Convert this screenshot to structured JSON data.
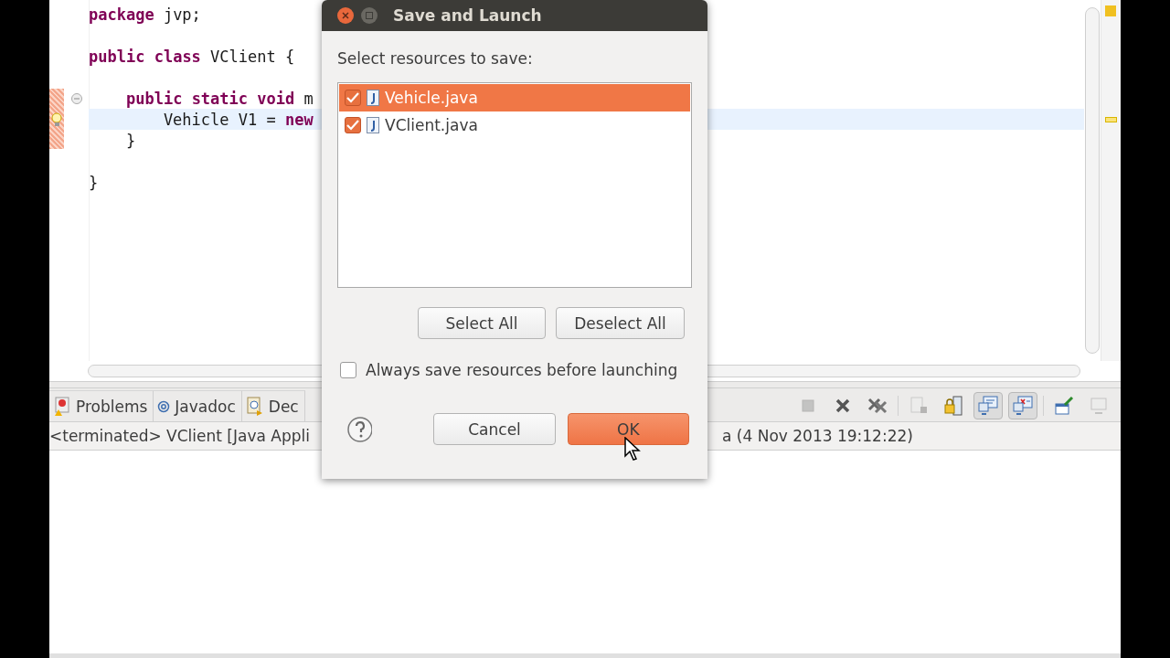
{
  "editor": {
    "lines": [
      {
        "kind": "code",
        "text": "**package** jvp;",
        "current": false,
        "fold": false,
        "warning": false
      },
      {
        "kind": "blank"
      },
      {
        "kind": "code",
        "text": "**public** **class** VClient {",
        "current": false,
        "fold": false,
        "warning": false
      },
      {
        "kind": "blank"
      },
      {
        "kind": "code",
        "text": "    **public** **static** **void** m",
        "current": false,
        "fold": true,
        "warning": false
      },
      {
        "kind": "code",
        "text": "        Vehicle V1 = **new**",
        "current": true,
        "fold": false,
        "warning": true
      },
      {
        "kind": "code",
        "text": "    }",
        "current": false,
        "fold": false,
        "warning": false
      },
      {
        "kind": "blank"
      },
      {
        "kind": "code",
        "text": "}",
        "current": false,
        "fold": false,
        "warning": false
      }
    ]
  },
  "panel": {
    "tabs": [
      {
        "kind": "problems",
        "label": "Problems",
        "selected": false
      },
      {
        "kind": "javadoc",
        "label": "Javadoc",
        "selected": false
      },
      {
        "kind": "declaration",
        "label": "Dec",
        "selected": false
      }
    ],
    "toolbar_groups": [
      {
        "items": [
          {
            "kind": "stop",
            "disabled": true,
            "pressed": false
          },
          {
            "kind": "remove",
            "disabled": false,
            "pressed": false
          },
          {
            "kind": "remove-all",
            "disabled": false,
            "pressed": false
          }
        ]
      },
      {
        "items": [
          {
            "kind": "word-wrap",
            "disabled": true,
            "pressed": false
          },
          {
            "kind": "scroll-lock",
            "disabled": false,
            "pressed": false
          },
          {
            "kind": "show-output",
            "disabled": false,
            "pressed": true
          },
          {
            "kind": "show-errors",
            "disabled": false,
            "pressed": true
          }
        ]
      },
      {
        "items": [
          {
            "kind": "pin",
            "disabled": false,
            "pressed": false
          },
          {
            "kind": "display",
            "disabled": true,
            "pressed": false
          }
        ]
      }
    ],
    "console_title_left": "<terminated> VClient [Java Appli",
    "console_title_right": "a (4 Nov 2013 19:12:22)"
  },
  "dialog": {
    "title": "Save and Launch",
    "prompt": "Select resources to save:",
    "resources": [
      {
        "name": "Vehicle.java",
        "checked": true,
        "selected": true
      },
      {
        "name": "VClient.java",
        "checked": true,
        "selected": false
      }
    ],
    "list_buttons": [
      "Select All",
      "Deselect All"
    ],
    "always_save": {
      "label": "Always save resources before launching",
      "checked": false
    },
    "buttons": [
      {
        "label": "Cancel",
        "highlighted": false
      },
      {
        "label": "OK",
        "highlighted": true
      }
    ]
  }
}
